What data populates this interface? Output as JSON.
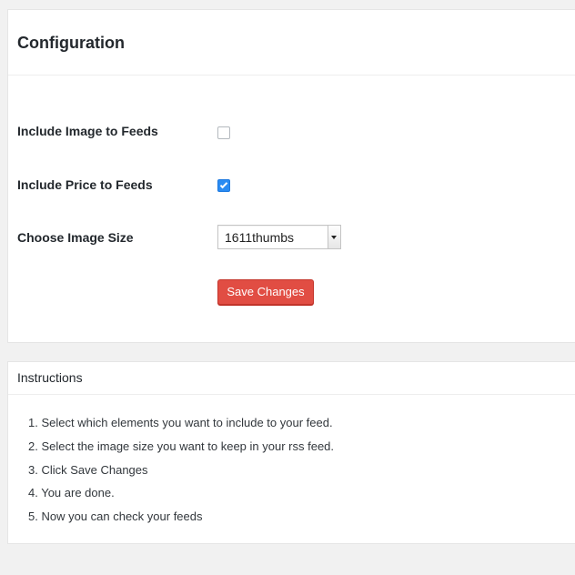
{
  "configuration": {
    "title": "Configuration",
    "rows": [
      {
        "label": "Include Image to Feeds",
        "checked": false
      },
      {
        "label": "Include Price to Feeds",
        "checked": true
      }
    ],
    "image_size": {
      "label": "Choose Image Size",
      "selected": "1611thumbs"
    },
    "save_label": "Save Changes"
  },
  "instructions": {
    "title": "Instructions",
    "steps": [
      "1. Select which elements you want to include to your feed.",
      "2. Select the image size you want to keep in your rss feed.",
      "3. Click Save Changes",
      "4. You are done.",
      "5. Now you can check your feeds"
    ]
  },
  "colors": {
    "save_button": "#e14d43",
    "checkbox_checked": "#2a8bf2",
    "background": "#f1f1f1"
  }
}
